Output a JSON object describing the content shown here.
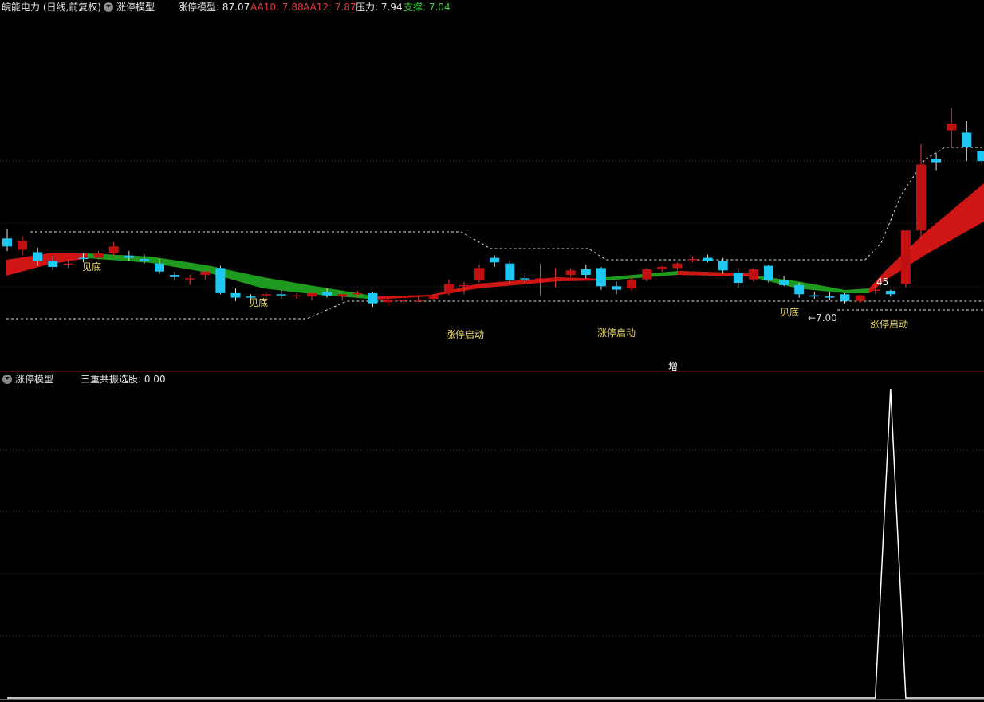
{
  "header": {
    "stock": "皖能电力 (日线,前复权)",
    "indicator_name": "涨停模型",
    "values": [
      {
        "label": "涨停模型: 87.07",
        "color": "#e6e6e6"
      },
      {
        "label": "AA10: 7.88",
        "color": "#e23b3b"
      },
      {
        "label": "AA12: 7.87",
        "color": "#e23b3b"
      },
      {
        "label": "压力: 7.94",
        "color": "#e6e6e6"
      },
      {
        "label": "支撑: 7.04",
        "color": "#3fd23f"
      }
    ]
  },
  "sub_panel": {
    "indicator_name": "涨停模型",
    "value_label": "三重共振选股: 0.00"
  },
  "annotations": {
    "bottom_1": "见底",
    "bottom_2": "见底",
    "bottom_3": "见底",
    "limit_up_1": "涨停启动",
    "limit_up_2": "涨停启动",
    "limit_up_3": "涨停启动",
    "low_price": "←7.00",
    "high_marker": "45",
    "zeng": "增"
  },
  "colors": {
    "up_candle": "#c01010",
    "down_candle": "#1ec8f5",
    "ribbon_red": "#d01515",
    "ribbon_green": "#1e9a1e",
    "text_yellow": "#e6d36a",
    "separator": "#8a1a1a"
  },
  "chart_data": [
    {
      "type": "candlestick",
      "panel": "main",
      "ohlc": [
        [
          7.55,
          7.63,
          7.44,
          7.48
        ],
        [
          7.45,
          7.57,
          7.4,
          7.53
        ],
        [
          7.43,
          7.47,
          7.31,
          7.35
        ],
        [
          7.35,
          7.4,
          7.27,
          7.3
        ],
        [
          7.33,
          7.37,
          7.29,
          7.33
        ],
        [
          7.38,
          7.42,
          7.34,
          7.37
        ],
        [
          7.38,
          7.44,
          7.36,
          7.42
        ],
        [
          7.42,
          7.52,
          7.4,
          7.48
        ],
        [
          7.4,
          7.44,
          7.35,
          7.38
        ],
        [
          7.37,
          7.41,
          7.33,
          7.35
        ],
        [
          7.33,
          7.37,
          7.24,
          7.26
        ],
        [
          7.23,
          7.26,
          7.18,
          7.21
        ],
        [
          7.19,
          7.23,
          7.14,
          7.2
        ],
        [
          7.23,
          7.27,
          7.19,
          7.26
        ],
        [
          7.29,
          7.31,
          7.06,
          7.07
        ],
        [
          7.07,
          7.11,
          7.0,
          7.03
        ],
        [
          7.04,
          7.06,
          7.0,
          7.03
        ],
        [
          7.06,
          7.08,
          7.03,
          7.06
        ],
        [
          7.06,
          7.1,
          7.02,
          7.05
        ],
        [
          7.05,
          7.07,
          7.02,
          7.05
        ],
        [
          7.04,
          7.08,
          7.01,
          7.07
        ],
        [
          7.08,
          7.11,
          7.03,
          7.05
        ],
        [
          7.04,
          7.07,
          7.01,
          7.06
        ],
        [
          7.07,
          7.09,
          7.04,
          7.07
        ],
        [
          7.07,
          7.08,
          6.95,
          6.98
        ],
        [
          6.99,
          7.02,
          6.96,
          7.01
        ],
        [
          7.0,
          7.03,
          6.98,
          7.01
        ],
        [
          7.01,
          7.04,
          6.99,
          7.01
        ],
        [
          7.02,
          7.06,
          7.0,
          7.05
        ],
        [
          7.07,
          7.19,
          7.05,
          7.15
        ],
        [
          7.13,
          7.17,
          7.06,
          7.14
        ],
        [
          7.18,
          7.32,
          7.16,
          7.29
        ],
        [
          7.38,
          7.4,
          7.3,
          7.34
        ],
        [
          7.33,
          7.36,
          7.15,
          7.18
        ],
        [
          7.2,
          7.25,
          7.16,
          7.19
        ],
        [
          7.19,
          7.33,
          7.05,
          7.2
        ],
        [
          7.2,
          7.29,
          7.12,
          7.2
        ],
        [
          7.23,
          7.29,
          7.21,
          7.27
        ],
        [
          7.28,
          7.32,
          7.2,
          7.23
        ],
        [
          7.29,
          7.3,
          7.1,
          7.13
        ],
        [
          7.13,
          7.17,
          7.06,
          7.1
        ],
        [
          7.11,
          7.21,
          7.09,
          7.19
        ],
        [
          7.19,
          7.29,
          7.17,
          7.28
        ],
        [
          7.28,
          7.31,
          7.26,
          7.3
        ],
        [
          7.29,
          7.34,
          7.27,
          7.33
        ],
        [
          7.36,
          7.39,
          7.34,
          7.37
        ],
        [
          7.38,
          7.41,
          7.34,
          7.35
        ],
        [
          7.35,
          7.38,
          7.24,
          7.27
        ],
        [
          7.25,
          7.29,
          7.12,
          7.16
        ],
        [
          7.19,
          7.29,
          7.17,
          7.28
        ],
        [
          7.31,
          7.32,
          7.16,
          7.18
        ],
        [
          7.18,
          7.22,
          7.13,
          7.14
        ],
        [
          7.14,
          7.16,
          7.03,
          7.06
        ],
        [
          7.05,
          7.08,
          7.02,
          7.04
        ],
        [
          7.04,
          7.08,
          7.01,
          7.03
        ],
        [
          7.06,
          7.07,
          6.98,
          7.0
        ],
        [
          7.0,
          7.06,
          6.98,
          7.05
        ],
        [
          7.1,
          7.14,
          7.06,
          7.1
        ],
        [
          7.09,
          7.1,
          7.04,
          7.06
        ],
        [
          7.15,
          7.62,
          7.12,
          7.62
        ],
        [
          7.62,
          8.38,
          7.55,
          8.2
        ],
        [
          8.25,
          8.3,
          8.15,
          8.22
        ],
        [
          8.5,
          8.7,
          8.35,
          8.56
        ],
        [
          8.48,
          8.58,
          8.23,
          8.35
        ],
        [
          8.32,
          8.35,
          8.19,
          8.23
        ],
        [
          8.19,
          8.29,
          8.15,
          8.12
        ],
        [
          8.17,
          8.24,
          7.94,
          8.08
        ]
      ]
    },
    {
      "type": "line",
      "panel": "sub",
      "title": "三重共振选股",
      "values": [
        0,
        0,
        0,
        0,
        0,
        0,
        0,
        0,
        0,
        0,
        0,
        0,
        0,
        0,
        0,
        0,
        0,
        0,
        0,
        0,
        0,
        0,
        0,
        0,
        0,
        0,
        0,
        0,
        0,
        0,
        0,
        0,
        0,
        0,
        0,
        0,
        0,
        0,
        0,
        0,
        0,
        0,
        0,
        0,
        0,
        0,
        0,
        0,
        0,
        0,
        0,
        0,
        0,
        0,
        0,
        0,
        0,
        0,
        1,
        0,
        0,
        0,
        0,
        0,
        0,
        0,
        0
      ],
      "ylim": [
        0,
        1
      ]
    }
  ]
}
